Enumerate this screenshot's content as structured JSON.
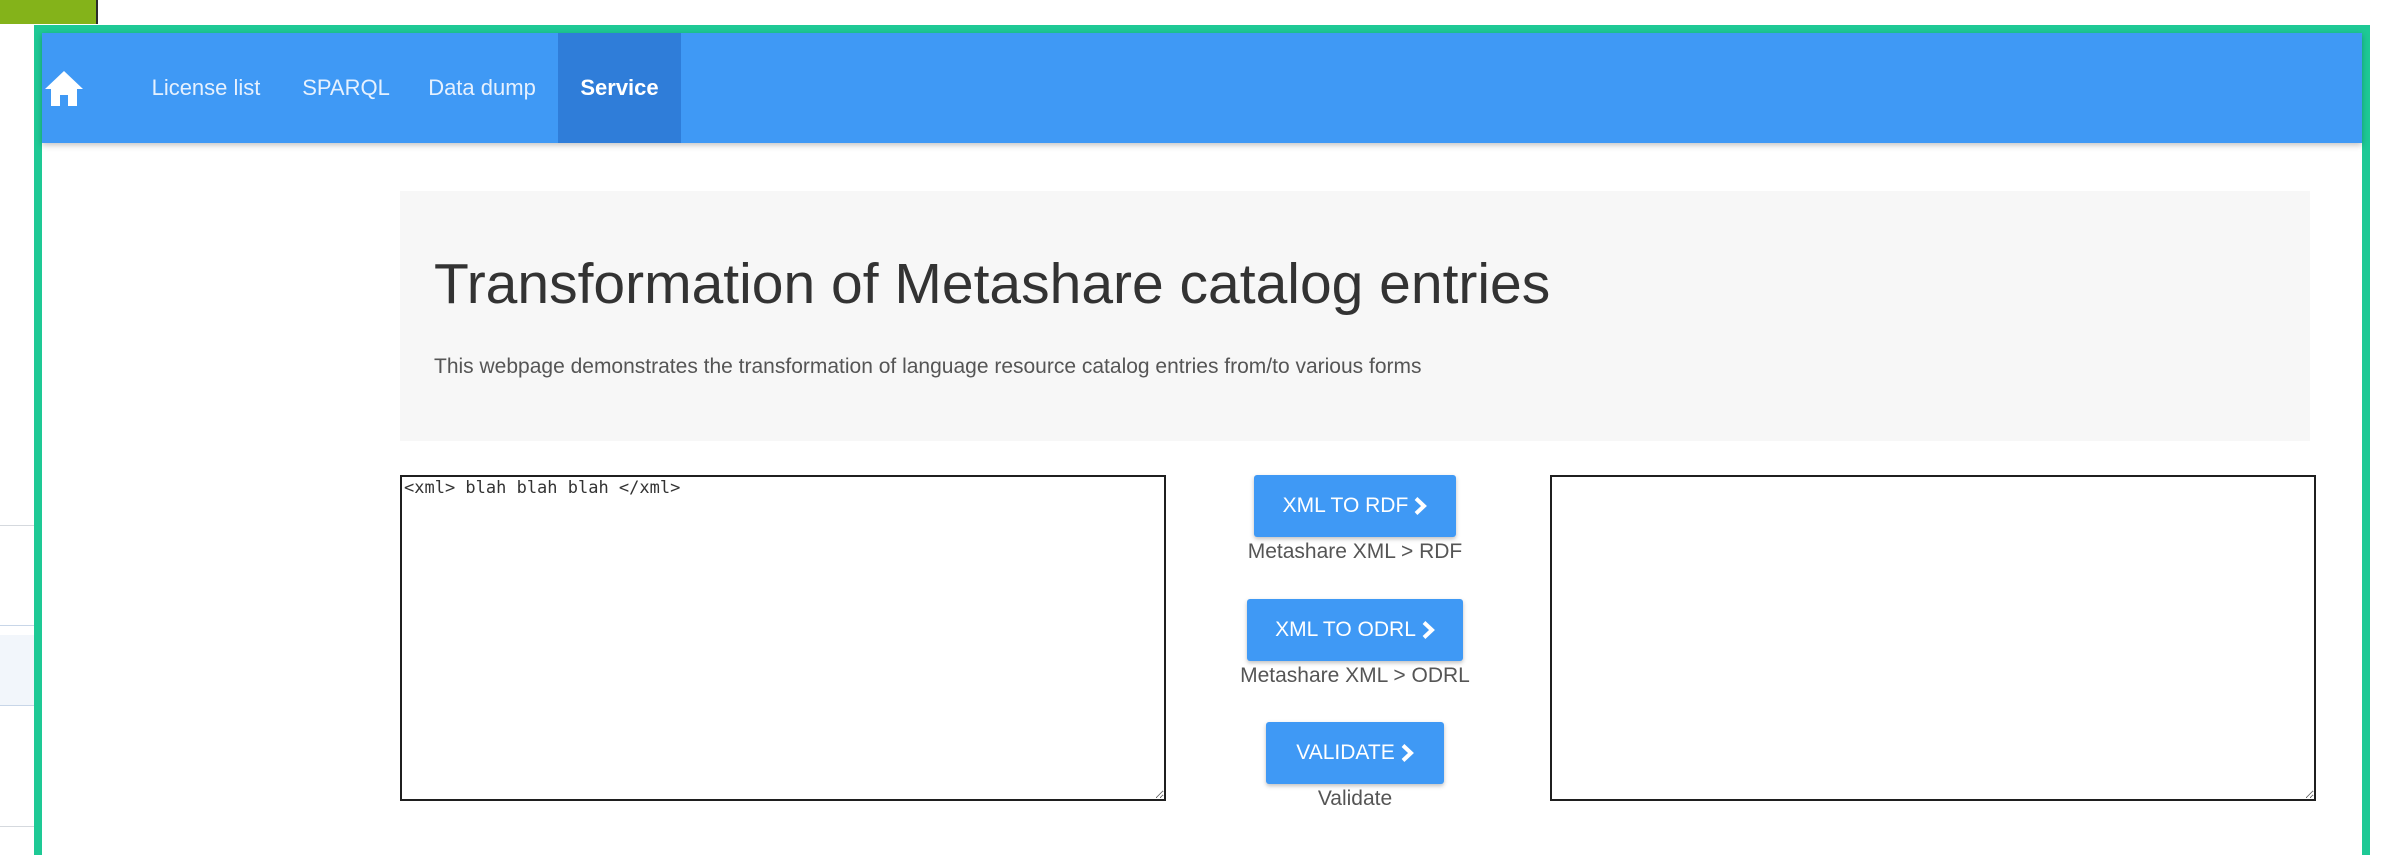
{
  "navbar": {
    "home_icon": "home-icon",
    "items": [
      {
        "label": "License list"
      },
      {
        "label": "SPARQL"
      },
      {
        "label": "Data dump"
      },
      {
        "label": "Service",
        "active": true
      }
    ]
  },
  "jumbotron": {
    "title": "Transformation of Metashare catalog entries",
    "description": "This webpage demonstrates the transformation of language resource catalog entries from/to various forms"
  },
  "input": {
    "value": "<xml> blah blah blah </xml>"
  },
  "output": {
    "value": ""
  },
  "actions": [
    {
      "label": "XML TO RDF",
      "caption": "Metashare XML > RDF",
      "icon": "chevron-right-icon"
    },
    {
      "label": "XML TO ODRL",
      "caption": "Metashare XML > ODRL",
      "icon": "chevron-right-icon"
    },
    {
      "label": "VALIDATE",
      "caption": "Validate",
      "icon": "chevron-right-icon"
    }
  ],
  "colors": {
    "navbar": "#3f99f5",
    "navbar_active": "#2f7dd9",
    "frame_border": "#1ec995",
    "button": "#3f99f5",
    "jumbotron_bg": "#f7f7f7"
  }
}
